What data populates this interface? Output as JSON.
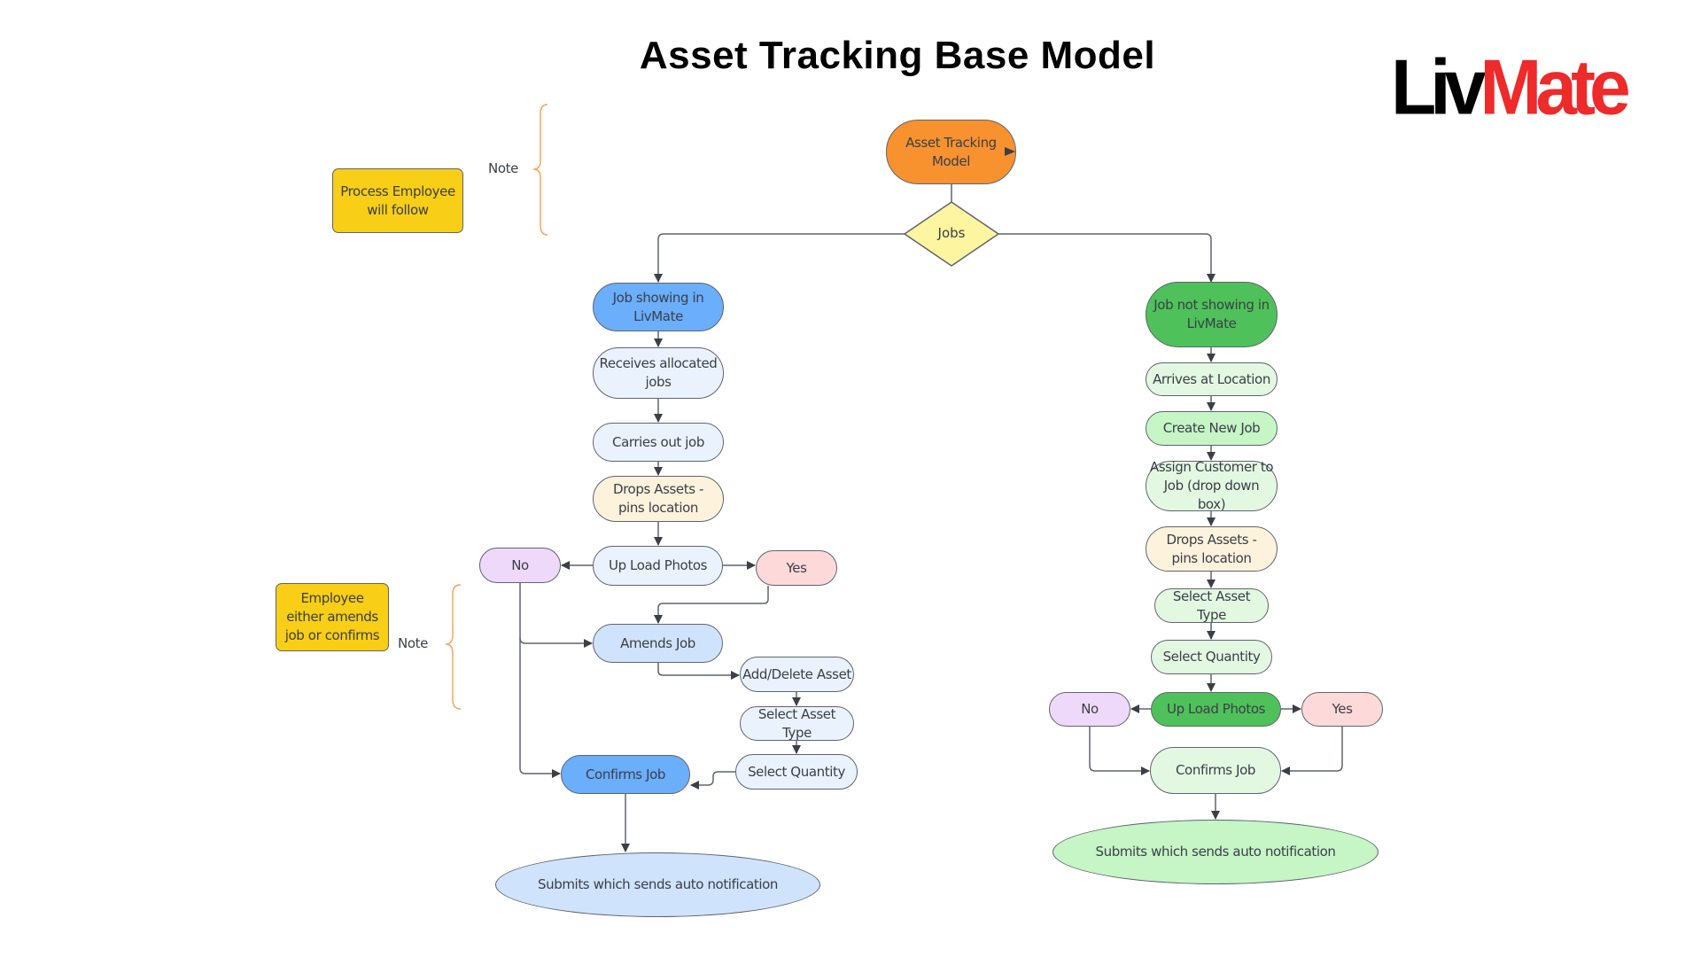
{
  "title": "Asset Tracking Base Model",
  "logo": {
    "part1": "Liv",
    "part2": "Mate",
    "colors": {
      "part1": "#000000",
      "part2": "#ee2a2a"
    }
  },
  "colors": {
    "start": "#f7922f",
    "decision": "#fdf5a0",
    "primary_blue": "#6aaefc",
    "light_blue": "#eaf3fd",
    "amend_blue": "#cfe3fc",
    "cream": "#fdf2dc",
    "purple": "#efd9fb",
    "pink": "#fdd9d9",
    "primary_green": "#4fc15a",
    "light_green": "#e3f8e1",
    "mid_green": "#c6f5c6",
    "note_yellow": "#f8ce16",
    "note_brace": "#f5a55a",
    "connector": "#5f6470"
  },
  "notes": [
    {
      "text": "Process Employee will follow",
      "label": "Note"
    },
    {
      "text": "Employee either amends job or confirms",
      "label": "Note"
    }
  ],
  "start": {
    "text": "Asset Tracking Model"
  },
  "decision": {
    "text": "Jobs"
  },
  "left_branch": {
    "head": "Job showing in LivMate",
    "receives": "Receives allocated jobs",
    "carries": "Carries out job",
    "drops": "Drops Assets - pins location",
    "upload": "Up Load Photos",
    "no": "No",
    "yes": "Yes",
    "amends": "Amends Job",
    "add_delete": "Add/Delete Asset",
    "asset_type": "Select Asset Type",
    "quantity": "Select Quantity",
    "confirms": "Confirms Job",
    "submits": "Submits which sends auto notification"
  },
  "right_branch": {
    "head": "Job not showing in LivMate",
    "arrives": "Arrives at Location",
    "create": "Create New Job",
    "assign": "Assign Customer to Job (drop down box)",
    "drops": "Drops Assets - pins location",
    "asset_type": "Select Asset Type",
    "quantity": "Select Quantity",
    "upload": "Up Load Photos",
    "no": "No",
    "yes": "Yes",
    "confirms": "Confirms Job",
    "submits": "Submits which sends auto notification"
  }
}
